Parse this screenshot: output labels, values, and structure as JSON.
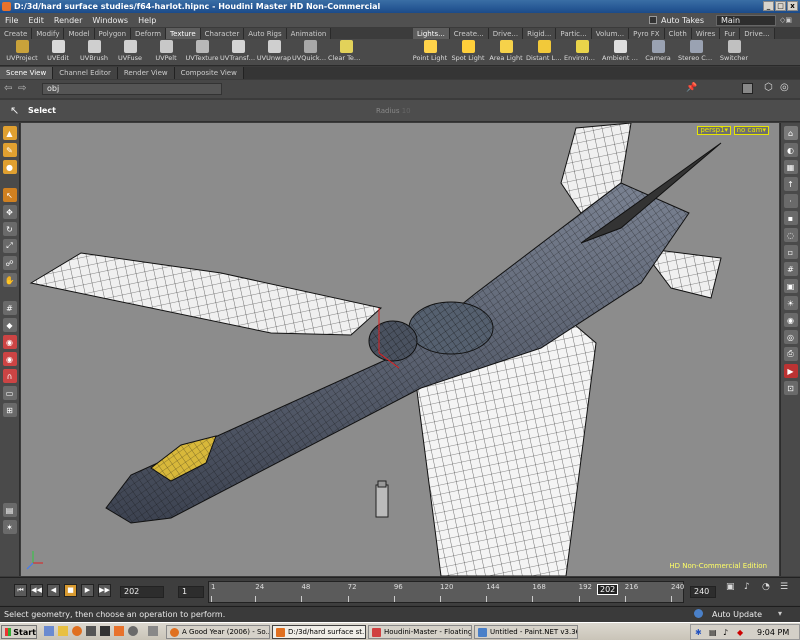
{
  "window": {
    "title": "D:/3d/hard surface studies/f64-harlot.hipnc - Houdini Master HD Non-Commercial",
    "min": "_",
    "max": "□",
    "close": "x"
  },
  "menu": {
    "items": [
      "File",
      "Edit",
      "Render",
      "Windows",
      "Help"
    ],
    "auto_takes": "Auto Takes",
    "desktop": "Main"
  },
  "shelf": {
    "left_tabs": [
      "Create",
      "Modify",
      "Model",
      "Polygon",
      "Deform",
      "Texture",
      "Character",
      "Auto Rigs",
      "Animation"
    ],
    "left_active": "Texture",
    "right_tabs": [
      "Lights...",
      "Create...",
      "Drive...",
      "Rigid...",
      "Partic...",
      "Volum...",
      "Pyro FX",
      "Cloth",
      "Wires",
      "Fur",
      "Drive..."
    ],
    "left_tools": [
      {
        "label": "UVProject",
        "icon": "uvproject-icon",
        "color": "#c9a23a"
      },
      {
        "label": "UVEdit",
        "icon": "uvedit-icon",
        "color": "#d9d9d9"
      },
      {
        "label": "UVBrush",
        "icon": "uvbrush-icon",
        "color": "#cfcfcf"
      },
      {
        "label": "UVFuse",
        "icon": "uvfuse-icon",
        "color": "#d0d0d0"
      },
      {
        "label": "UVPelt",
        "icon": "uvpelt-icon",
        "color": "#c8c8c8"
      },
      {
        "label": "UVTexture",
        "icon": "uvtexture-icon",
        "color": "#b8b8b8"
      },
      {
        "label": "UVTransfo...",
        "icon": "uvtransform-icon",
        "color": "#d4d4d4"
      },
      {
        "label": "UVUnwrap",
        "icon": "uvunwrap-icon",
        "color": "#cfcfcf"
      },
      {
        "label": "UVQuickS...",
        "icon": "uvquickshade-icon",
        "color": "#a8a8a8"
      },
      {
        "label": "Clear Text...",
        "icon": "clear-texture-icon",
        "color": "#e2d25a"
      }
    ],
    "right_tools": [
      {
        "label": "Point Light",
        "icon": "point-light-icon",
        "color": "#ffd34a"
      },
      {
        "label": "Spot Light",
        "icon": "spot-light-icon",
        "color": "#ffcf3a"
      },
      {
        "label": "Area Light",
        "icon": "area-light-icon",
        "color": "#f6d24a"
      },
      {
        "label": "Distant Li...",
        "icon": "distant-light-icon",
        "color": "#f2c93a"
      },
      {
        "label": "Environm...",
        "icon": "environment-light-icon",
        "color": "#e9d44a"
      },
      {
        "label": "Ambient L...",
        "icon": "ambient-light-icon",
        "color": "#dedede"
      },
      {
        "label": "Camera",
        "icon": "camera-icon",
        "color": "#9aa2b2"
      },
      {
        "label": "Stereo Ca...",
        "icon": "stereo-camera-icon",
        "color": "#9aa2b2"
      },
      {
        "label": "Switcher",
        "icon": "switcher-icon",
        "color": "#c0c0c0"
      }
    ]
  },
  "panes": {
    "tabs": [
      "Scene View",
      "Channel Editor",
      "Render View",
      "Composite View"
    ],
    "active": "Scene View",
    "path": "obj"
  },
  "operation": {
    "label": "Select",
    "radius_label": "Radius",
    "radius_value": "10"
  },
  "viewport": {
    "camera": "persp1▾",
    "camera_menu": "no cam▾",
    "edition": "HD Non-Commercial Edition",
    "colors": {
      "bg": "#8c8c8c",
      "fuselage": "#5a6070",
      "wing": "#f0f0f0",
      "wire": "#1a1a1a",
      "cockpit": "#d8b83a"
    }
  },
  "playbar": {
    "frame": "202",
    "step": "1",
    "ticks": [
      "1",
      "24",
      "48",
      "72",
      "96",
      "120",
      "144",
      "168",
      "192",
      "216",
      "240"
    ],
    "current": "202",
    "end": "240",
    "auto_update": "Auto Update",
    "buttons": [
      "⏮",
      "◀◀",
      "◀",
      "■",
      "▶",
      "▶▶",
      "⏭"
    ]
  },
  "status": {
    "message": "Select geometry, then choose an operation to perform."
  },
  "taskbar": {
    "start": "Start",
    "tasks": [
      {
        "label": "A Good Year (2006) - So...",
        "color": "#e07020"
      },
      {
        "label": "D:/3d/hard surface st...",
        "color": "#e07020",
        "active": true
      },
      {
        "label": "Houdini-Master - Floating...",
        "color": "#d04040"
      },
      {
        "label": "Untitled - Paint.NET v3.36",
        "color": "#4a80c8"
      }
    ],
    "clock": "9:04 PM"
  }
}
